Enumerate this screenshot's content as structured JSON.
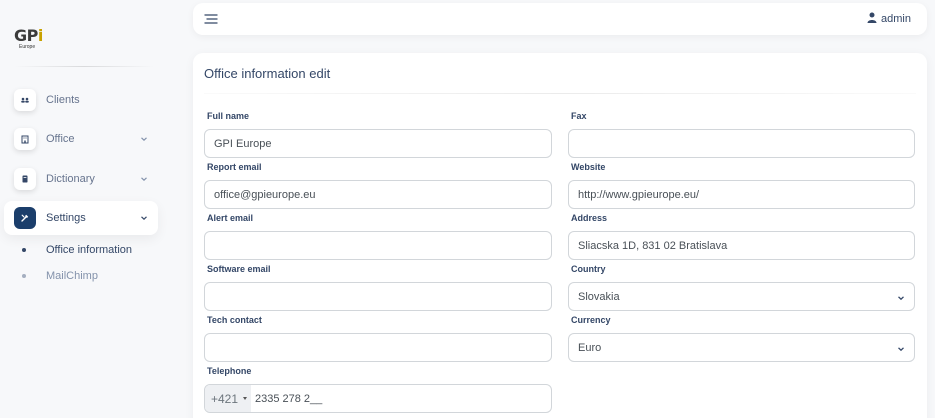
{
  "brand": {
    "logo_text": "GPi",
    "logo_sub": "Europe"
  },
  "sidebar": {
    "items": [
      {
        "label": "Clients",
        "icon": "clients-icon"
      },
      {
        "label": "Office",
        "icon": "office-icon"
      },
      {
        "label": "Dictionary",
        "icon": "dictionary-icon"
      },
      {
        "label": "Settings",
        "icon": "settings-icon",
        "active": true
      }
    ],
    "sub_items": [
      {
        "label": "Office information",
        "active": true
      },
      {
        "label": "MailChimp",
        "active": false
      }
    ]
  },
  "topbar": {
    "menu_icon": "menu-icon",
    "user_label": "admin",
    "user_icon": "user-icon"
  },
  "form": {
    "title": "Office information edit",
    "full_name": {
      "label": "Full name",
      "value": "GPI Europe"
    },
    "report_email": {
      "label": "Report email",
      "value": "office@gpieurope.eu"
    },
    "alert_email": {
      "label": "Alert email",
      "value": ""
    },
    "software_email": {
      "label": "Software email",
      "value": ""
    },
    "tech_contact": {
      "label": "Tech contact",
      "value": ""
    },
    "telephone": {
      "label": "Telephone",
      "prefix": "+421",
      "value": "2335 278 2__"
    },
    "fax": {
      "label": "Fax",
      "value": ""
    },
    "website": {
      "label": "Website",
      "value": "http://www.gpieurope.eu/"
    },
    "address": {
      "label": "Address",
      "value": "Sliacska 1D, 831 02 Bratislava"
    },
    "country": {
      "label": "Country",
      "value": "Slovakia"
    },
    "currency": {
      "label": "Currency",
      "value": "Euro"
    }
  },
  "colors": {
    "accent": "#1b3e6b",
    "text": "#344767",
    "muted": "#8392ab",
    "border": "#d2d6da",
    "background": "#f7f8fa"
  }
}
